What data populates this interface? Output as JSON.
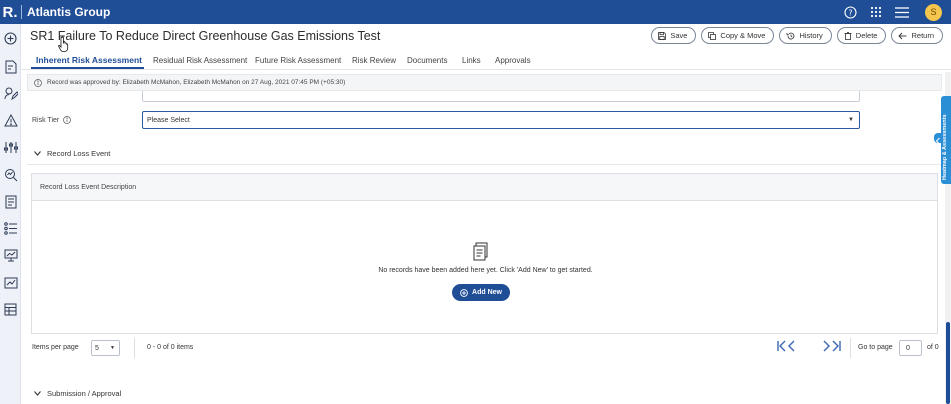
{
  "app": {
    "logo_letter": "R.",
    "org_name": "Atlantis Group",
    "user_initial": "S"
  },
  "record": {
    "title": "SR1 Failure To Reduce Direct Greenhouse Gas Emissions Test"
  },
  "actions": [
    {
      "label": "Save",
      "icon": "save-icon"
    },
    {
      "label": "Copy & Move",
      "icon": "copy-icon"
    },
    {
      "label": "History",
      "icon": "history-icon"
    },
    {
      "label": "Delete",
      "icon": "trash-icon"
    },
    {
      "label": "Return",
      "icon": "return-icon"
    }
  ],
  "tabs": [
    {
      "label": "Inherent Risk Assessment",
      "active": true
    },
    {
      "label": "Residual Risk Assessment"
    },
    {
      "label": "Future Risk Assessment"
    },
    {
      "label": "Risk Review"
    },
    {
      "label": "Documents"
    },
    {
      "label": "Links"
    },
    {
      "label": "Approvals"
    }
  ],
  "banner": {
    "text": "Record was approved by: Elizabeth McMahon, Elizabeth McMahon on 27 Aug, 2021 07:45 PM (+05:30)"
  },
  "risk_tier": {
    "label": "Risk Tier",
    "value": "Please Select"
  },
  "loss_event": {
    "section_label": "Record Loss Event",
    "column_header": "Record Loss Event Description",
    "empty_message": "No records have been added here yet. Click 'Add New' to get started.",
    "add_new_label": "Add New"
  },
  "pager": {
    "items_per_page_label": "Items per page",
    "page_size": "5",
    "count_text": "0 - 0 of 0 items",
    "go_to_label": "Go to page",
    "page_value": "0",
    "of_text": "of 0"
  },
  "submission": {
    "section_label": "Submission / Approval"
  },
  "side_panel": {
    "label": "Heatmap & Assessments"
  },
  "colors": {
    "brand": "#1f4d96",
    "side_panel": "#2b8fd6",
    "avatar": "#f4c64e"
  },
  "left_rail_icons": [
    "plus-circle-icon",
    "document-add-icon",
    "user-edit-icon",
    "warning-icon",
    "sliders-icon",
    "search-chart-icon",
    "report-icon",
    "checklist-icon",
    "monitor-icon",
    "trend-icon",
    "table-icon"
  ]
}
